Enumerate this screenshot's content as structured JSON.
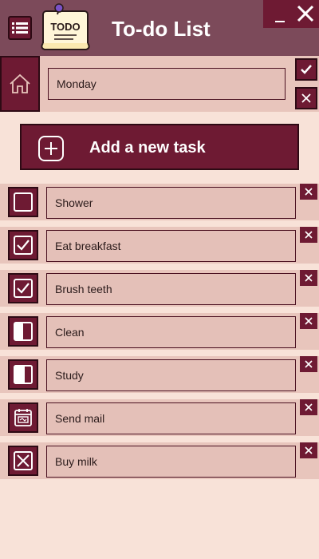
{
  "app": {
    "title": "To-do List",
    "logo_text": "TODO"
  },
  "window": {
    "minimize_icon": "minimize-icon",
    "close_icon": "close-icon"
  },
  "day": {
    "value": "Monday",
    "home_icon": "home-icon"
  },
  "add_task": {
    "label": "Add a new task",
    "icon": "plus-square-icon"
  },
  "tasks": [
    {
      "label": "Shower",
      "state": "unchecked"
    },
    {
      "label": "Eat breakfast",
      "state": "checked"
    },
    {
      "label": "Brush teeth",
      "state": "checked"
    },
    {
      "label": "Clean",
      "state": "half-left"
    },
    {
      "label": "Study",
      "state": "half-right"
    },
    {
      "label": "Send mail",
      "state": "calendar"
    },
    {
      "label": "Buy milk",
      "state": "crossed"
    }
  ],
  "colors": {
    "background": "#f8e2d8",
    "header": "#7c4a5a",
    "accent": "#6e1a33",
    "row": "#e8c5bc",
    "field": "#e4c0b8"
  }
}
